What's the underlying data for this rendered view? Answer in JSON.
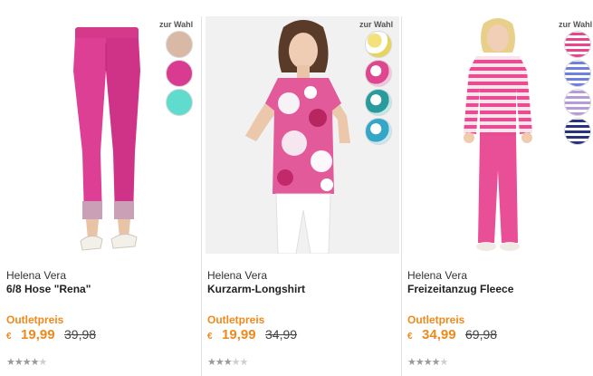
{
  "colors": {
    "accent": "#f0891c",
    "pink": "#e0468f",
    "cyan": "#54d8c9",
    "beige": "#d7b7a4"
  },
  "swatch_label": "zur Wahl",
  "products": [
    {
      "brand": "Helena Vera",
      "name": "6/8 Hose \"Rena\"",
      "price_label": "Outletpreis",
      "currency": "€",
      "price": "19,99",
      "old_price": "39,98",
      "rating": 4,
      "swatches": [
        "beige",
        "pink",
        "turquoise"
      ]
    },
    {
      "brand": "Helena Vera",
      "name": "Kurzarm-Longshirt",
      "price_label": "Outletpreis",
      "currency": "€",
      "price": "19,99",
      "old_price": "34,99",
      "rating": 3,
      "swatches": [
        "yellow-floral",
        "pink-floral",
        "teal-floral",
        "blue-floral"
      ]
    },
    {
      "brand": "Helena Vera",
      "name": "Freizeitanzug Fleece",
      "price_label": "Outletpreis",
      "currency": "€",
      "price": "34,99",
      "old_price": "69,98",
      "rating": 4,
      "swatches": [
        "pink-stripe",
        "blue-stripe",
        "lilac-stripe",
        "navy-stripe"
      ]
    }
  ]
}
